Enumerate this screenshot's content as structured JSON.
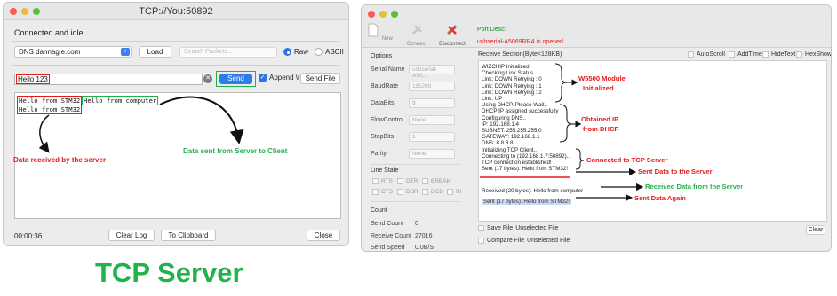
{
  "left_window": {
    "title": "TCP://You:50892",
    "status": "Connected and idle.",
    "dns_value": "DNS dannagle.com",
    "load_label": "Load",
    "search_placeholder": "Search Packets...",
    "raw_label": "Raw",
    "ascii_label": "ASCII",
    "message_value": "Hello 123",
    "send_label": "Send",
    "append_label": "Append \\r",
    "send_file_label": "Send File",
    "log_lines": [
      {
        "text": "Hello from STM32"
      },
      {
        "text": "Hello from computer"
      },
      {
        "text": "Hello from STM32"
      }
    ],
    "timer": "00:00:36",
    "clear_log_label": "Clear Log",
    "to_clipboard_label": "To Clipboard",
    "close_label": "Close"
  },
  "left_annotations": {
    "received": "Data received by the server",
    "sent": "Data sent from Server to Client",
    "caption": "TCP Server"
  },
  "right_window": {
    "toolbar": {
      "new_label": "New",
      "connect_label": "Connect",
      "disconnect_label": "Disconnect"
    },
    "port_desc_label": "Port Desc:",
    "port_status": "usbserial-A5069RR4 is opened",
    "options_label": "Options",
    "fields": [
      {
        "label": "Serial Name",
        "value": "usbserial-A50..."
      },
      {
        "label": "BaudRate",
        "value": "115200"
      },
      {
        "label": "DataBits",
        "value": "8"
      },
      {
        "label": "FlowControl",
        "value": "None"
      },
      {
        "label": "StopBits",
        "value": "1"
      },
      {
        "label": "Parity",
        "value": "None"
      }
    ],
    "line_state_label": "Line State",
    "line_state_row1": [
      "RTS",
      "DTR",
      "BREAK"
    ],
    "line_state_row2": [
      "CTS",
      "DSR",
      "DCD",
      "RI"
    ],
    "count_label": "Count",
    "send_count_label": "Send Count",
    "send_count_value": "0",
    "receive_count_label": "Receive Count",
    "receive_count_value": "27016",
    "send_speed_label": "Send Speed",
    "send_speed_value": "0.0B/S",
    "receive_section_label": "Receive Section(Byte<128KB)",
    "auto_scroll": "AutoScroll",
    "add_time": "AddTime",
    "hide_text": "HideText",
    "hex_show": "HexShow",
    "receive_lines": [
      "WIZCHIP Initialized",
      "Checking Link Status..",
      "Link: DOWN Retrying : 0",
      "Link: DOWN Retrying : 1",
      "Link: DOWN Retrying : 2",
      "Link: UP",
      "Using DHCP. Please Wait..",
      "DHCP IP assigned successfully",
      "Configuring DNS..",
      "IP: 192.168.1.4",
      "SUBNET: 255.255.255.0",
      "GATEWAY: 192.168.1.1",
      "DNS: 8.8.8.8",
      "Initializing TCP Client..",
      "Connecting to (192.168.1.7:50892)..",
      "TCP connection established!",
      "Sent (17 bytes): Hello from STM32!"
    ],
    "received_line": "Received (20 bytes): Hello from computer",
    "sent_again_line": "Sent (17 bytes): Hello from STM32!",
    "clear_label": "Clear",
    "save_file_label": "Save File",
    "save_file_value": "Unselected File",
    "compare_file_label": "Compare File",
    "compare_file_value": "Unselected File"
  },
  "right_annotations": {
    "w5500_line1": "W5500 Module",
    "w5500_line2": "Initialized",
    "dhcp_line1": "Obtained IP",
    "dhcp_line2": "from DHCP",
    "connected": "Connected to TCP Server",
    "sent": "Sent Data to the Server",
    "received": "Received Data from the Server",
    "sent_again": "Sent Data Again"
  },
  "colors": {
    "annotation_red": "#e31c1c",
    "annotation_green": "#22b24c",
    "send_button_blue": "#2e7de9"
  }
}
